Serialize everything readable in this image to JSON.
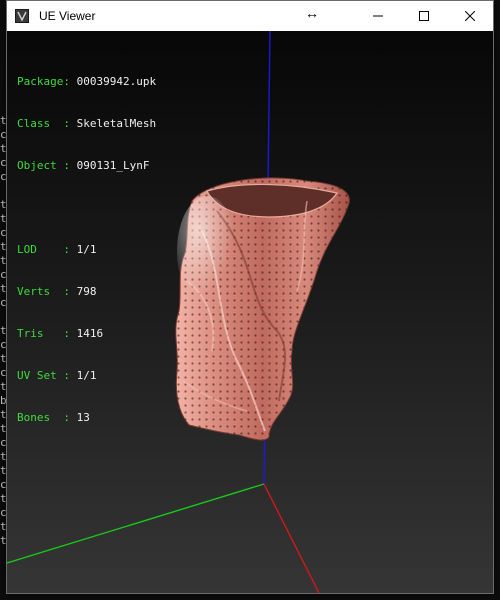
{
  "window": {
    "title": "UE Viewer",
    "minimize_icon": "minimize-icon",
    "maximize_icon": "maximize-icon",
    "close_icon": "close-icon"
  },
  "info": {
    "package_label": "Package:",
    "package_value": "00039942.upk",
    "class_label": "Class  :",
    "class_value": "SkeletalMesh",
    "object_label": "Object :",
    "object_value": "090131_LynF",
    "lod_label": "LOD    :",
    "lod_value": "1/1",
    "verts_label": "Verts  :",
    "verts_value": "798",
    "tris_label": "Tris   :",
    "tris_value": "1416",
    "uvset_label": "UV Set :",
    "uvset_value": "1/1",
    "bones_label": "Bones  :",
    "bones_value": "13"
  },
  "colors": {
    "label": "#3ddc3d",
    "value": "#f0f0f0",
    "axis_x": "#d01818",
    "axis_y": "#18c818",
    "axis_z": "#1a1ad8",
    "mesh": "#d98a7c"
  }
}
